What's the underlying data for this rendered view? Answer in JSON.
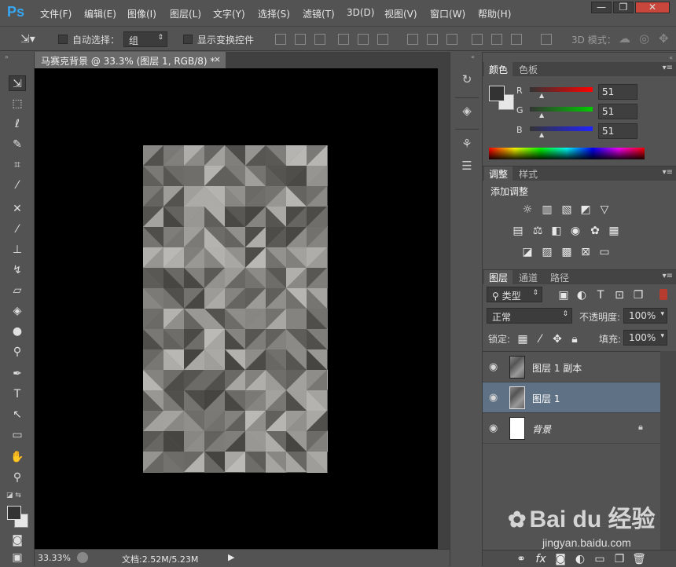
{
  "app": {
    "logo": "Ps"
  },
  "menu": [
    "文件(F)",
    "编辑(E)",
    "图像(I)",
    "图层(L)",
    "文字(Y)",
    "选择(S)",
    "滤镜(T)",
    "3D(D)",
    "视图(V)",
    "窗口(W)",
    "帮助(H)"
  ],
  "window_controls": {
    "minimize": "—",
    "restore": "❐",
    "close": "✕"
  },
  "options": {
    "auto_select_label": "自动选择：",
    "auto_select_value": "组",
    "show_transform_label": "显示变换控件",
    "mode_3d_label": "3D 模式："
  },
  "document": {
    "tab_title": "马赛克背景 @ 33.3% (图层 1, RGB/8) *",
    "close": "×"
  },
  "status": {
    "zoom": "33.33%",
    "doc_info": "文档:2.52M/5.23M"
  },
  "color_panel": {
    "tabs": [
      "颜色",
      "色板"
    ],
    "channels": [
      {
        "label": "R",
        "value": "51"
      },
      {
        "label": "G",
        "value": "51"
      },
      {
        "label": "B",
        "value": "51"
      }
    ],
    "foreground": "#333333",
    "background": "#e6e6e6"
  },
  "adjust_panel": {
    "tabs": [
      "调整",
      "样式"
    ],
    "title": "添加调整"
  },
  "layers_panel": {
    "tabs": [
      "图层",
      "通道",
      "路径"
    ],
    "filter_label": "类型",
    "blend_mode": "正常",
    "opacity_label": "不透明度:",
    "opacity_value": "100%",
    "lock_label": "锁定:",
    "fill_label": "填充:",
    "fill_value": "100%",
    "layers": [
      {
        "name": "图层 1 副本",
        "selected": false
      },
      {
        "name": "图层 1",
        "selected": true
      },
      {
        "name": "背景",
        "selected": false,
        "locked": true
      }
    ]
  },
  "watermark": {
    "brand": "Bai du 经验",
    "url": "jingyan.baidu.com"
  }
}
